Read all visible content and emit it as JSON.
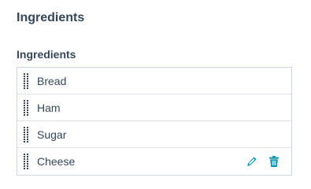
{
  "section": {
    "title": "Ingredients"
  },
  "field": {
    "label": "Ingredients"
  },
  "ingredients": {
    "items": [
      {
        "label": "Bread"
      },
      {
        "label": "Ham"
      },
      {
        "label": "Sugar"
      },
      {
        "label": "Cheese"
      }
    ]
  },
  "icons": {
    "drag": "drag-handle-icon",
    "edit": "pencil-icon",
    "delete": "trash-icon"
  },
  "colors": {
    "text": "#33475b",
    "accent": "#0091ae",
    "border": "#cbd6e2",
    "handle": "#33475b"
  }
}
